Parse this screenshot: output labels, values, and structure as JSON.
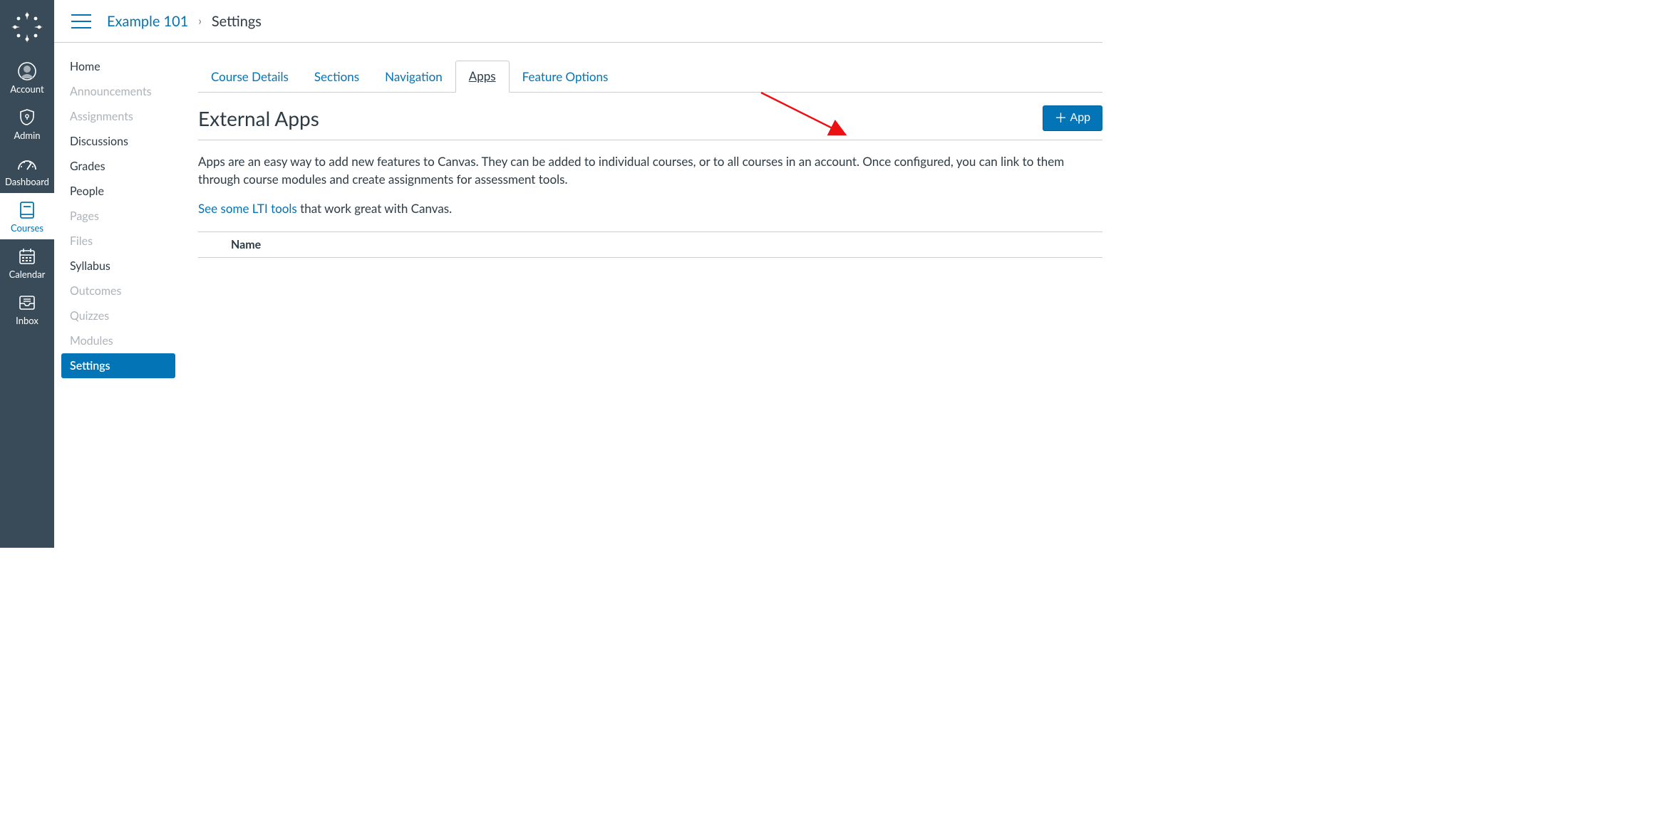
{
  "colors": {
    "brand": "#0374b5",
    "nav_bg": "#394b58"
  },
  "global_nav": {
    "items": [
      {
        "key": "account",
        "label": "Account"
      },
      {
        "key": "admin",
        "label": "Admin"
      },
      {
        "key": "dashboard",
        "label": "Dashboard"
      },
      {
        "key": "courses",
        "label": "Courses",
        "active": true
      },
      {
        "key": "calendar",
        "label": "Calendar"
      },
      {
        "key": "inbox",
        "label": "Inbox"
      }
    ]
  },
  "breadcrumb": {
    "course_link": "Example 101",
    "separator": "›",
    "current": "Settings"
  },
  "course_nav": {
    "items": [
      {
        "label": "Home",
        "state": "enabled"
      },
      {
        "label": "Announcements",
        "state": "disabled"
      },
      {
        "label": "Assignments",
        "state": "disabled"
      },
      {
        "label": "Discussions",
        "state": "enabled"
      },
      {
        "label": "Grades",
        "state": "enabled"
      },
      {
        "label": "People",
        "state": "enabled"
      },
      {
        "label": "Pages",
        "state": "disabled"
      },
      {
        "label": "Files",
        "state": "disabled"
      },
      {
        "label": "Syllabus",
        "state": "enabled"
      },
      {
        "label": "Outcomes",
        "state": "disabled"
      },
      {
        "label": "Quizzes",
        "state": "disabled"
      },
      {
        "label": "Modules",
        "state": "disabled"
      },
      {
        "label": "Settings",
        "state": "active"
      }
    ]
  },
  "tabs": {
    "items": [
      {
        "label": "Course Details"
      },
      {
        "label": "Sections"
      },
      {
        "label": "Navigation"
      },
      {
        "label": "Apps",
        "active": true
      },
      {
        "label": "Feature Options"
      }
    ]
  },
  "header": {
    "title": "External Apps",
    "add_button_label": "App"
  },
  "description": "Apps are an easy way to add new features to Canvas. They can be added to individual courses, or to all courses in an account. Once configured, you can link to them through course modules and create assignments for assessment tools.",
  "lti_link_text": "See some LTI tools",
  "lti_trailing_text": " that work great with Canvas.",
  "table": {
    "columns": [
      "Name"
    ]
  }
}
